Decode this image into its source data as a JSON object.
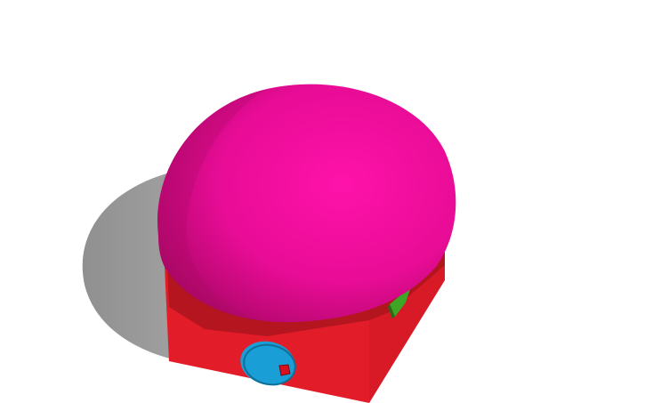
{
  "scene": {
    "background": "#ffffff",
    "objects": [
      {
        "name": "shadow",
        "shape": "ellipse",
        "color": "#8a8a8a"
      },
      {
        "name": "base-box",
        "shape": "box",
        "color": "#e0202a"
      },
      {
        "name": "roof-dome",
        "shape": "half-sphere",
        "color": "#ff10a8"
      },
      {
        "name": "door",
        "shape": "cylinder",
        "color": "#1a9ed6"
      },
      {
        "name": "door-knob",
        "shape": "box",
        "color": "#e0202a"
      },
      {
        "name": "window",
        "shape": "wedge",
        "color": "#3aa022"
      }
    ]
  },
  "colors": {
    "shadow": "#8a8a8a",
    "box_front": "#e21d29",
    "box_left": "#c41521",
    "box_right": "#d81a26",
    "box_shaded": "#8e0f18",
    "dome_light": "#ff12aa",
    "dome_mid": "#e80c96",
    "dome_dark": "#a2065f",
    "door": "#1a9ed6",
    "door_dark": "#0f6f99",
    "knob": "#d6121f",
    "window": "#3ea526",
    "window_dark": "#246d12"
  }
}
